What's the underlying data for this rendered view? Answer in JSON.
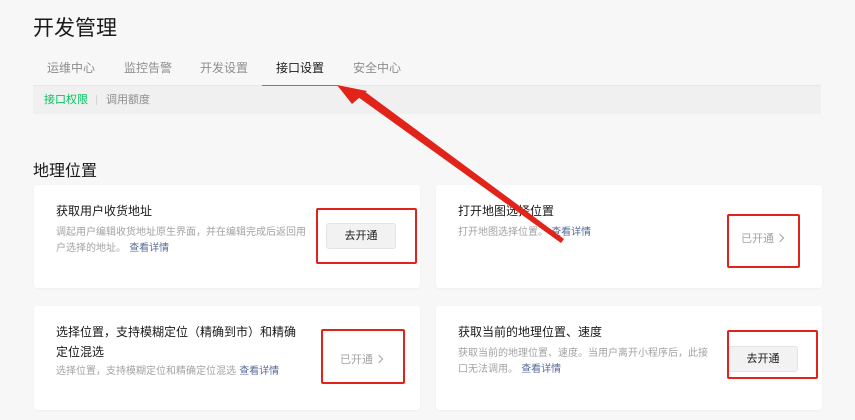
{
  "page": {
    "title": "开发管理"
  },
  "tabs": [
    {
      "label": "运维中心"
    },
    {
      "label": "监控告警"
    },
    {
      "label": "开发设置"
    },
    {
      "label": "接口设置"
    },
    {
      "label": "安全中心"
    }
  ],
  "active_tab": "接口设置",
  "subtabs": [
    {
      "label": "接口权限"
    },
    {
      "label": "调用额度"
    }
  ],
  "active_subtab": "接口权限",
  "section": {
    "title": "地理位置"
  },
  "cards": [
    {
      "title": "获取用户收货地址",
      "desc": "调起用户编辑收货地址原生界面，并在编辑完成后返回用户选择的地址。",
      "link": "查看详情",
      "action": "去开通"
    },
    {
      "title": "打开地图选择位置",
      "desc": "打开地图选择位置。",
      "link": "查看详情",
      "status": "已开通"
    },
    {
      "title": "选择位置，支持模糊定位（精确到市）和精确定位混选",
      "desc": "选择位置，支持模糊定位和精确定位混选",
      "link": "查看详情",
      "status": "已开通"
    },
    {
      "title": "获取当前的地理位置、速度",
      "desc": "获取当前的地理位置、速度。当用户离开小程序后，此接口无法调用。",
      "link": "查看详情",
      "action": "去开通"
    }
  ],
  "colors": {
    "accent": "#07c160",
    "link": "#576b95",
    "annotation": "#e2231a"
  }
}
